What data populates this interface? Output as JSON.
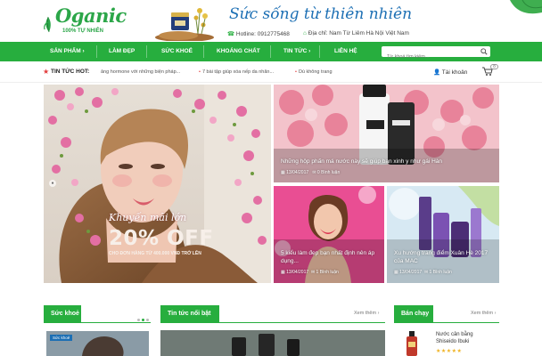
{
  "header": {
    "logo_text": "Oganic",
    "logo_sub": "100% TỰ NHIÊN",
    "slogan": "Sức sống từ thiên nhiên",
    "hotline": "Hotline: 0912775468",
    "address": "Địa chỉ: Nam Từ Liêm Hà Nội Việt Nam"
  },
  "nav": {
    "items": [
      "SẢN PHẨM ›",
      "LÀM ĐẸP",
      "SỨC KHOẺ",
      "KHOÁNG CHẤT",
      "TIN TỨC ›",
      "LIÊN HỆ"
    ],
    "search_placeholder": "Từ khoá tìm kiếm..."
  },
  "ticker": {
    "label": "TIN TỨC HOT:",
    "items": [
      "ảng hormone với những biện pháp...",
      "7 bài tập giúp xóa nếp da nhăn...",
      "Dù không trang"
    ],
    "account": "Tài khoản",
    "cart_count": "0"
  },
  "hero": {
    "promo_line1": "Khuyến mãi lớn",
    "promo_line2": "20% OFF",
    "promo_line3": "CHO ĐƠN HÀNG TỪ 400.000 VNĐ TRỞ LÊN",
    "tiles": [
      {
        "title": "Những hộp phấn má nước này sẽ giúp bạn xinh y như gái Hàn",
        "date": "13/04/2017",
        "comments": "0 Bình luận"
      },
      {
        "title": "5 kiểu làm đẹp bạn nhất định nên áp dụng...",
        "date": "13/04/2017",
        "comments": "1 Bình luận"
      },
      {
        "title": "Xu hướng trang điểm Xuân Hè 2017 của MAC",
        "date": "13/04/2017",
        "comments": "1 Bình luận"
      }
    ]
  },
  "sections": {
    "health": {
      "title": "Sức khoẻ",
      "badge": "Sức khoẻ"
    },
    "news": {
      "title": "Tin tức nổi bật",
      "view_more": "Xem thêm ›"
    },
    "best": {
      "title": "Bán chạy",
      "view_more": "Xem thêm ›",
      "product": "Nước cân bằng Shiseido Ibuki",
      "stars": "★★★★★"
    }
  },
  "colors": {
    "brand_green": "#27ae3e",
    "slogan_blue": "#1c6fb4",
    "hot_red": "#e23b3b"
  }
}
